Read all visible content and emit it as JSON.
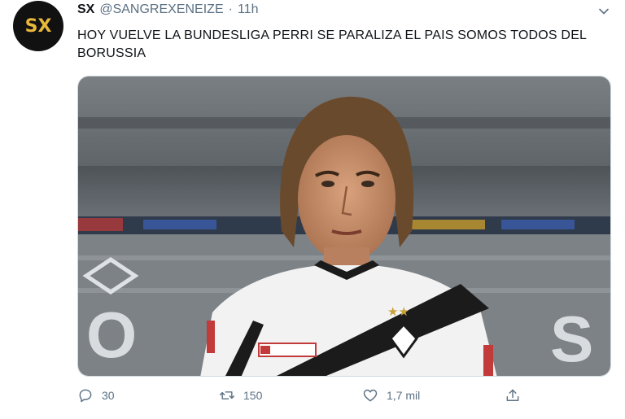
{
  "tweet": {
    "avatar_text": "SX",
    "display_name": "SX",
    "handle": "@SANGREXENEIZE",
    "separator": "·",
    "time": "11h",
    "text": "HOY VUELVE LA BUNDESLIGA PERRI SE PARALIZA EL PAIS SOMOS TODOS DEL BORUSSIA",
    "media_alt": "photo",
    "actions": {
      "replies": "30",
      "retweets": "150",
      "likes": "1,7 mil"
    }
  },
  "colors": {
    "avatar_bg": "#111111",
    "avatar_text": "#e8b83a",
    "secondary_text": "#5b7083",
    "primary_text": "#0f1419"
  },
  "icons": [
    "chevron-down-icon",
    "reply-icon",
    "retweet-icon",
    "like-icon",
    "share-icon"
  ]
}
